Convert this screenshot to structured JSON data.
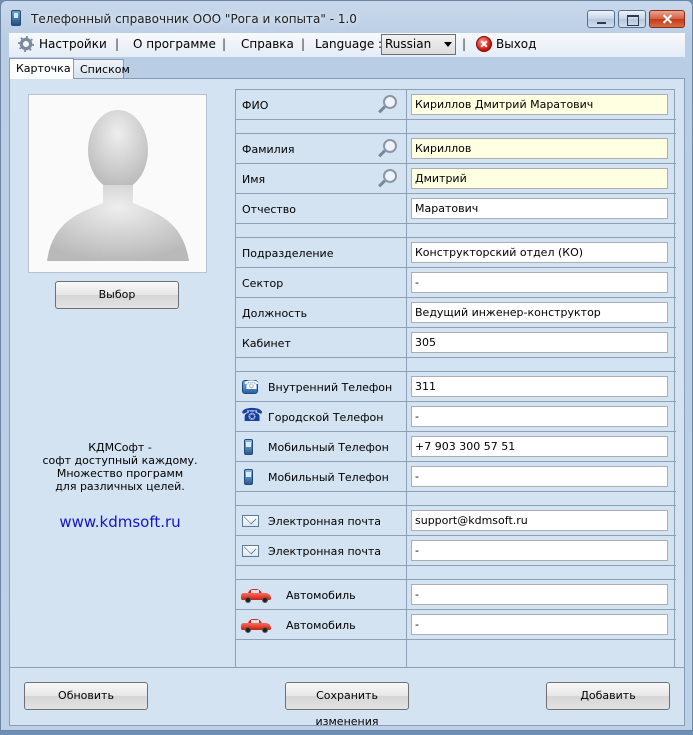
{
  "window": {
    "title": "Телефонный справочник ООО \"Рога и копыта\" - 1.0"
  },
  "menu": {
    "settings": "Настройки",
    "about": "О программе",
    "help": "Справка",
    "language_label": "Language :",
    "language_value": "Russian",
    "exit": "Выход",
    "separator": "|"
  },
  "tabs": {
    "card": "Карточка",
    "list": "Списком"
  },
  "left": {
    "select_button": "Выбор",
    "promo_line1": "КДМСофт -",
    "promo_line2": "софт доступный каждому.",
    "promo_line3": "Множество программ",
    "promo_line4": "для различных целей.",
    "url": "www.kdmsoft.ru"
  },
  "fields": {
    "fio": {
      "label": "ФИО",
      "value": "Кириллов Дмитрий Маратович"
    },
    "last_name": {
      "label": "Фамилия",
      "value": "Кириллов"
    },
    "first_name": {
      "label": "Имя",
      "value": "Дмитрий"
    },
    "patronymic": {
      "label": "Отчество",
      "value": "Маратович"
    },
    "department": {
      "label": "Подразделение",
      "value": "Конструкторский отдел (КО)"
    },
    "sector": {
      "label": "Сектор",
      "value": "-"
    },
    "position": {
      "label": "Должность",
      "value": "Ведущий инженер-конструктор"
    },
    "office": {
      "label": "Кабинет",
      "value": "305"
    },
    "internal_phone": {
      "label": "Внутренний Телефон",
      "value": "311"
    },
    "city_phone": {
      "label": "Городской Телефон",
      "value": "-"
    },
    "mobile_phone_1": {
      "label": "Мобильный Телефон",
      "value": "+7 903 300 57 51"
    },
    "mobile_phone_2": {
      "label": "Мобильный Телефон",
      "value": "-"
    },
    "email_1": {
      "label": "Электронная почта",
      "value": "support@kdmsoft.ru"
    },
    "email_2": {
      "label": "Электронная почта",
      "value": "-"
    },
    "car_1": {
      "label": "Автомобиль",
      "value": "-"
    },
    "car_2": {
      "label": "Автомобиль",
      "value": "-"
    }
  },
  "buttons": {
    "refresh": "Обновить",
    "save": "Сохранить изменения",
    "add": "Добавить"
  },
  "colors": {
    "highlight_field": "#ffffe1",
    "panel": "#d4e3f2",
    "link": "#1414c8"
  }
}
